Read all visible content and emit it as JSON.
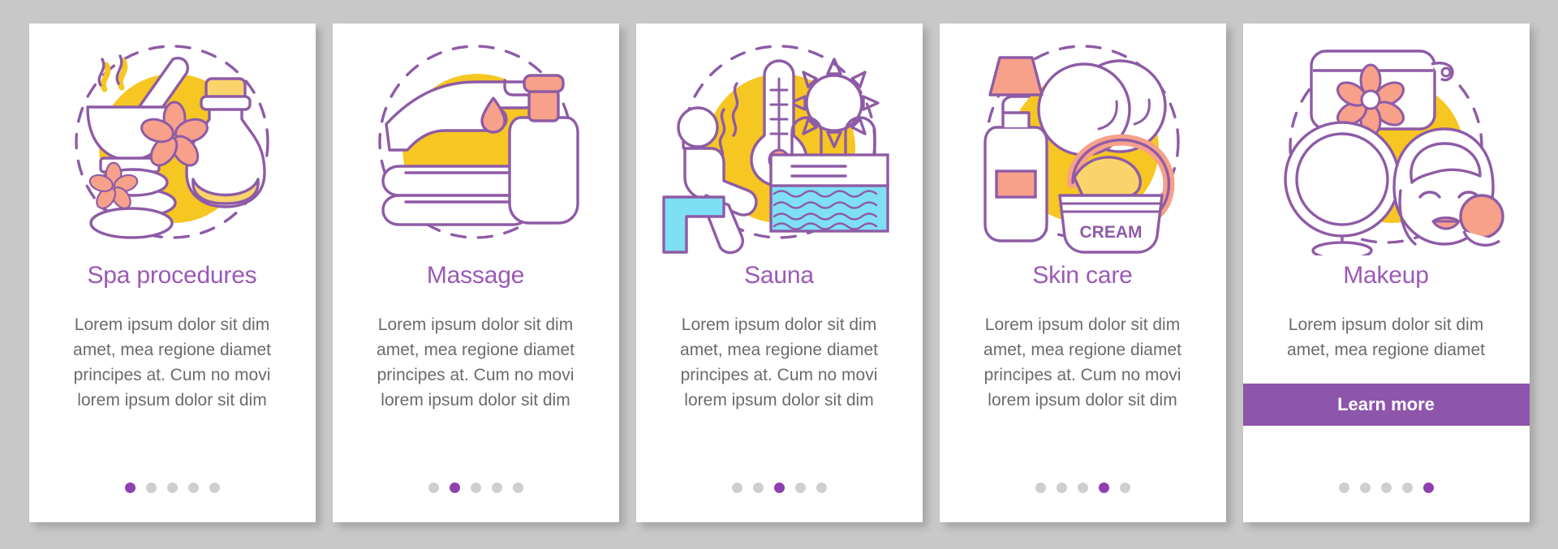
{
  "theme": {
    "background": "#c8c8c8",
    "card_background": "#ffffff",
    "title_color": "#9b59b6",
    "body_color": "#6b6b6b",
    "accent_purple": "#8e56ab",
    "accent_yellow": "#f6c622",
    "accent_pink": "#f7a08a",
    "accent_blue": "#7fe0f5",
    "dot_inactive": "#cfcfcf",
    "dot_active": "#8e3fb0"
  },
  "cards": [
    {
      "title": "Spa procedures",
      "description": "Lorem ipsum dolor sit dim amet, mea regione diamet principes at. Cum no movi lorem ipsum dolor sit dim",
      "illustration": "spa-procedures-illustration",
      "dots_total": 5,
      "dots_active_index": 1,
      "has_button": false
    },
    {
      "title": "Massage",
      "description": "Lorem ipsum dolor sit dim amet, mea regione diamet principes at. Cum no movi lorem ipsum dolor sit dim",
      "illustration": "massage-illustration",
      "dots_total": 5,
      "dots_active_index": 2,
      "has_button": false
    },
    {
      "title": "Sauna",
      "description": "Lorem ipsum dolor sit dim amet, mea regione diamet principes at. Cum no movi lorem ipsum dolor sit dim",
      "illustration": "sauna-illustration",
      "dots_total": 5,
      "dots_active_index": 3,
      "has_button": false
    },
    {
      "title": "Skin care",
      "description": "Lorem ipsum dolor sit dim amet, mea regione diamet principes at. Cum no movi lorem ipsum dolor sit dim",
      "illustration": "skin-care-illustration",
      "illustration_label": "CREAM",
      "dots_total": 5,
      "dots_active_index": 4,
      "has_button": false
    },
    {
      "title": "Makeup",
      "description": "Lorem ipsum dolor sit dim amet, mea regione diamet",
      "illustration": "makeup-illustration",
      "dots_total": 5,
      "dots_active_index": 5,
      "has_button": true,
      "button_label": "Learn more"
    }
  ]
}
